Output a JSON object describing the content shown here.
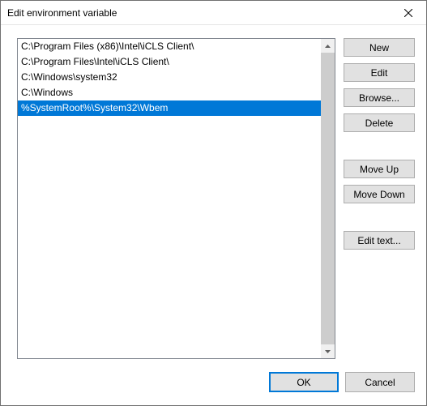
{
  "window": {
    "title": "Edit environment variable"
  },
  "list": {
    "items": [
      {
        "text": "C:\\Program Files (x86)\\Intel\\iCLS Client\\",
        "selected": false
      },
      {
        "text": "C:\\Program Files\\Intel\\iCLS Client\\",
        "selected": false
      },
      {
        "text": "C:\\Windows\\system32",
        "selected": false
      },
      {
        "text": "C:\\Windows",
        "selected": false
      },
      {
        "text": "%SystemRoot%\\System32\\Wbem",
        "selected": true
      }
    ],
    "selected_index": 4
  },
  "buttons": {
    "new": "New",
    "edit": "Edit",
    "browse": "Browse...",
    "delete": "Delete",
    "move_up": "Move Up",
    "move_down": "Move Down",
    "edit_text": "Edit text...",
    "ok": "OK",
    "cancel": "Cancel"
  }
}
